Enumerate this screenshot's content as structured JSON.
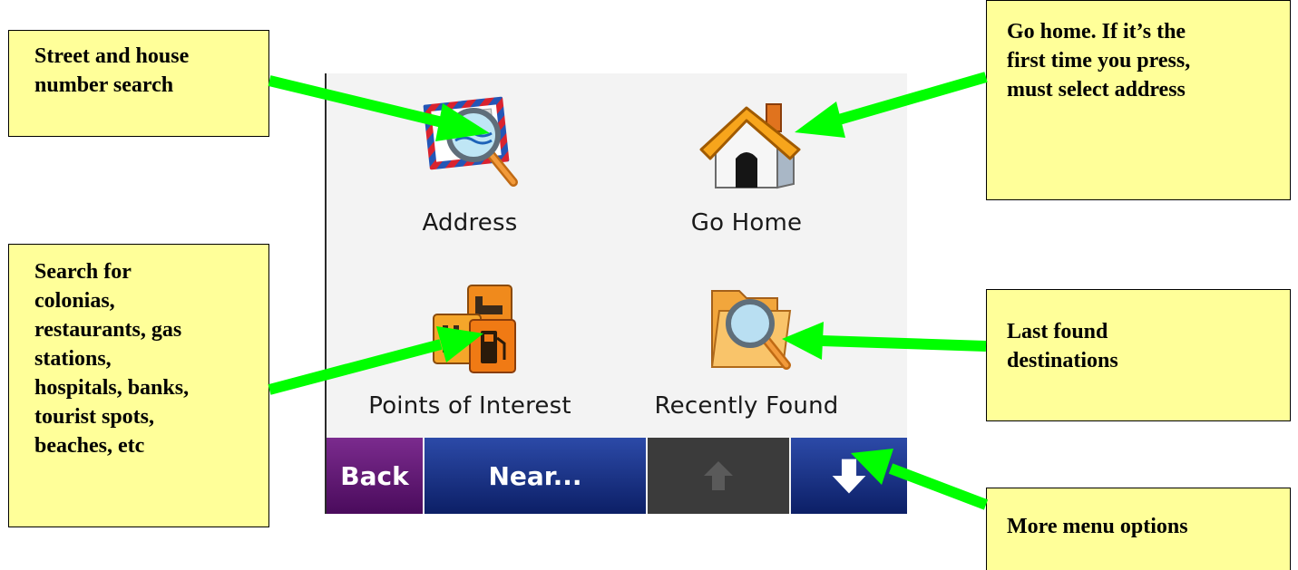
{
  "callouts": {
    "street": [
      "Street and house",
      "number search"
    ],
    "poi": [
      "Search for",
      "colonias,",
      "restaurants, gas",
      "stations,",
      "hospitals, banks,",
      "tourist spots,",
      "beaches, etc"
    ],
    "home": [
      "Go home. If it’s the",
      "first time you press,",
      "must select address"
    ],
    "recent": [
      "Last found",
      "destinations"
    ],
    "more": [
      "More menu options"
    ]
  },
  "menu": {
    "address": {
      "label": "Address",
      "icon": "address-magnifier-icon"
    },
    "go_home": {
      "label": "Go Home",
      "icon": "house-icon"
    },
    "poi": {
      "label": "Points of Interest",
      "icon": "poi-icon"
    },
    "recent": {
      "label": "Recently Found",
      "icon": "folder-search-icon"
    }
  },
  "toolbar": {
    "back": "Back",
    "near": "Near...",
    "up": "up-arrow-icon",
    "down": "down-arrow-icon"
  },
  "colors": {
    "callout_bg": "#ffff99",
    "arrow": "#00ff00",
    "back_btn": "#5e1672",
    "near_btn": "#1a2f86",
    "disabled_btn": "#3b3b3b"
  }
}
